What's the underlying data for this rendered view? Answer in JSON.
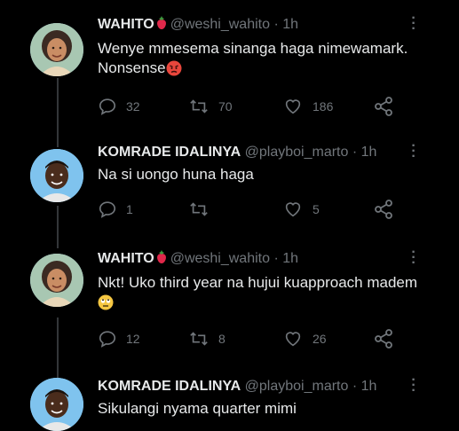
{
  "tweets": [
    {
      "name": "WAHITO",
      "name_emoji": "strawberry",
      "handle": "@weshi_wahito",
      "separator": "·",
      "time": "1h",
      "text": "Wenye mmesema sinanga haga nimewamark. Nonsense",
      "text_emoji": "angry-face",
      "replies": "32",
      "retweets": "70",
      "likes": "186"
    },
    {
      "name": "KOMRADE IDALINYA",
      "handle": "@playboi_marto",
      "separator": "·",
      "time": "1h",
      "text": "Na si uongo huna haga",
      "replies": "1",
      "retweets": "",
      "likes": "5"
    },
    {
      "name": "WAHITO",
      "name_emoji": "strawberry",
      "handle": "@weshi_wahito",
      "separator": "·",
      "time": "1h",
      "text": "Nkt! Uko third year na hujui kuapproach madem",
      "text_emoji": "eye-roll-face",
      "replies": "12",
      "retweets": "8",
      "likes": "26"
    },
    {
      "name": "KOMRADE IDALINYA",
      "handle": "@playboi_marto",
      "separator": "·",
      "time": "1h",
      "text": "Sikulangi nyama quarter mimi"
    }
  ],
  "icons": {
    "reply": "reply-icon",
    "retweet": "retweet-icon",
    "like": "heart-icon",
    "share": "share-icon",
    "more": "more-options-icon"
  },
  "colors": {
    "background": "#000000",
    "text": "#e7e9ea",
    "muted": "#71767b",
    "thread_line": "#333639"
  }
}
